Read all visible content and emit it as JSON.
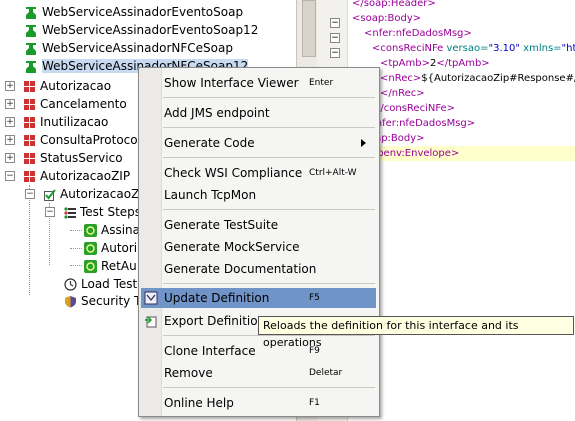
{
  "tree": {
    "items": [
      {
        "label": "WebServiceAssinadorEventoSoap",
        "icon": "soap-binding-icon"
      },
      {
        "label": "WebServiceAssinadorEventoSoap12",
        "icon": "soap-binding-icon"
      },
      {
        "label": "WebServiceAssinadorNFCeSoap",
        "icon": "soap-binding-icon"
      },
      {
        "label": "WebServiceAssinadorNFCeSoap12",
        "icon": "soap-binding-icon"
      },
      {
        "label": "Autorizacao",
        "icon": "testsuite-icon"
      },
      {
        "label": "Cancelamento",
        "icon": "testsuite-icon"
      },
      {
        "label": "Inutilizacao",
        "icon": "testsuite-icon"
      },
      {
        "label": "ConsultaProtocolo",
        "icon": "testsuite-icon"
      },
      {
        "label": "StatusServico",
        "icon": "testsuite-icon"
      },
      {
        "label": "AutorizacaoZIP",
        "icon": "testsuite-icon"
      },
      {
        "label": "AutorizacaoZi",
        "icon": "testcase-check-icon"
      },
      {
        "label": "Test Steps",
        "icon": "test-steps-icon"
      },
      {
        "label": "Assina",
        "icon": "soap-step-icon"
      },
      {
        "label": "Autori",
        "icon": "soap-step-icon"
      },
      {
        "label": "RetAu",
        "icon": "soap-step-icon"
      },
      {
        "label": "Load Test",
        "icon": "load-test-icon"
      },
      {
        "label": "Security T",
        "icon": "security-test-icon"
      }
    ]
  },
  "xml": {
    "lines": [
      {
        "t": "</soap:Header>"
      },
      {
        "t": "<soap:Body>"
      },
      {
        "t": "<nfer:nfeDadosMsg>"
      },
      {
        "t": "<consReciNFe",
        "a": " versao=",
        "v": "\"3.10\"",
        "a2": " xmlns=",
        "v2": "\"http:/"
      },
      {
        "t": "<tpAmb>",
        "x": "2",
        "t2": "</tpAmb>"
      },
      {
        "t": "<nRec>",
        "x": "${AutorizacaoZip#Response#//*:"
      },
      {
        "t": "</nRec>"
      },
      {
        "t": "</consReciNFe>"
      },
      {
        "t": "</nfer:nfeDadosMsg>"
      },
      {
        "t": "</soap:Body>"
      },
      {
        "t": "</soapenv:Envelope>"
      }
    ]
  },
  "menu": {
    "items": [
      {
        "label": "Show Interface Viewer",
        "shortcut": "Enter"
      },
      {
        "label": "Add JMS endpoint",
        "shortcut": ""
      },
      {
        "label": "Generate Code",
        "shortcut": ""
      },
      {
        "label": "Check WSI Compliance",
        "shortcut": "Ctrl+Alt-W"
      },
      {
        "label": "Launch TcpMon",
        "shortcut": ""
      },
      {
        "label": "Generate TestSuite",
        "shortcut": ""
      },
      {
        "label": "Generate MockService",
        "shortcut": ""
      },
      {
        "label": "Generate Documentation",
        "shortcut": ""
      },
      {
        "label": "Update Definition",
        "shortcut": "F5"
      },
      {
        "label": "Export Definition",
        "shortcut": ""
      },
      {
        "label": "Clone Interface",
        "shortcut": "F9"
      },
      {
        "label": "Remove",
        "shortcut": "Deletar"
      },
      {
        "label": "Online Help",
        "shortcut": "F1"
      }
    ]
  },
  "tooltip": {
    "text": "Reloads the definition for this interface and its operations"
  },
  "colors": {
    "highlight": "#7093c8",
    "selection": "#c7daf1",
    "tooltip_bg": "#ffffe1"
  }
}
